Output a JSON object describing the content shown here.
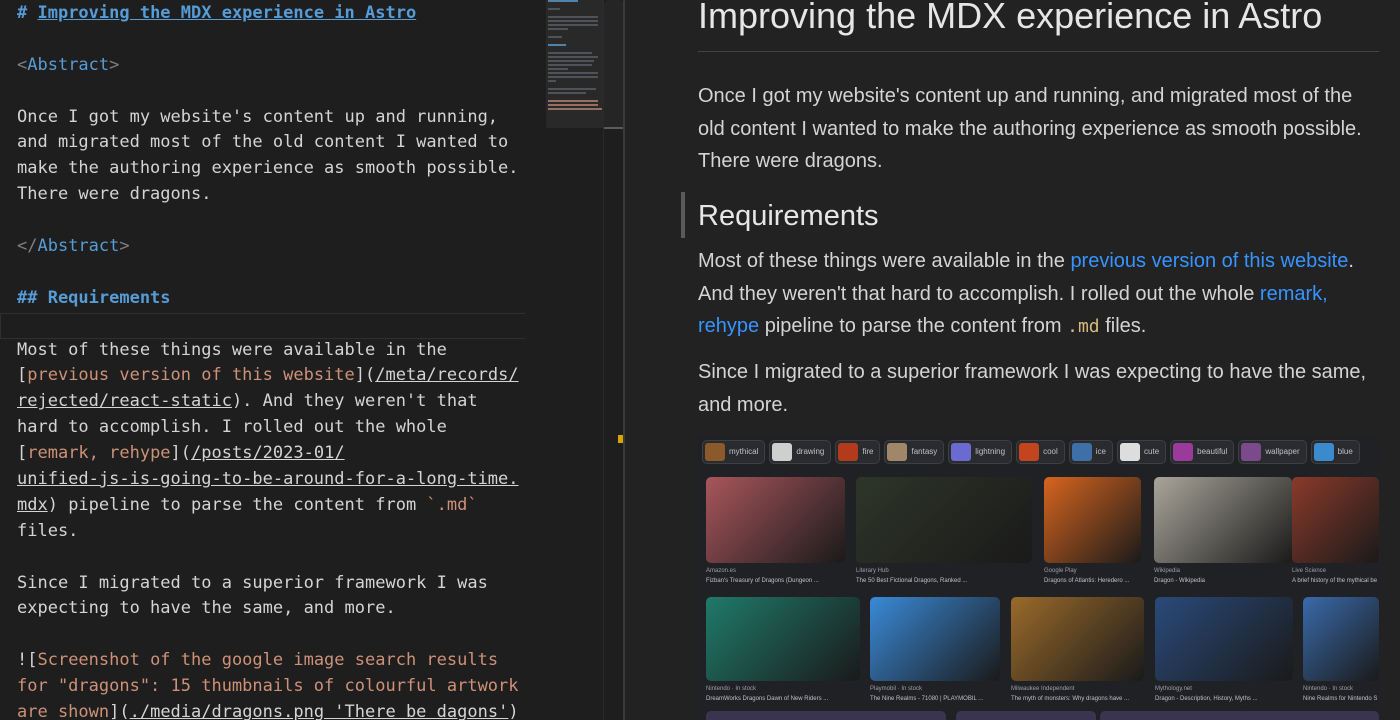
{
  "editor": {
    "lines": [
      {
        "k": "h1",
        "prefix": "# ",
        "text": "Improving the MDX experience in Astro"
      },
      {
        "k": "blank"
      },
      {
        "k": "tagopen",
        "name": "Abstract"
      },
      {
        "k": "blank"
      },
      {
        "k": "text",
        "text": "Once I got my website's content up and running,"
      },
      {
        "k": "text",
        "text": "and migrated most of the old content I wanted to"
      },
      {
        "k": "text",
        "text": "make the authoring experience as smooth possible."
      },
      {
        "k": "text",
        "text": "There were dragons."
      },
      {
        "k": "blank"
      },
      {
        "k": "tagclose",
        "name": "Abstract"
      },
      {
        "k": "blank"
      },
      {
        "k": "h2",
        "text": "## Requirements"
      },
      {
        "k": "blank"
      },
      {
        "k": "text",
        "text": "Most of these things were available in the"
      },
      {
        "k": "link1",
        "open": "[",
        "label": "previous version of this website",
        "mid": "](",
        "url": "/meta/records/"
      },
      {
        "k": "link1b",
        "url": "rejected/react-static",
        "rest": "). And they weren't that"
      },
      {
        "k": "text",
        "text": "hard to accomplish. I rolled out the whole"
      },
      {
        "k": "link2",
        "open": "[",
        "label": "remark, rehype",
        "mid": "](",
        "url": "/posts/2023-01/"
      },
      {
        "k": "urlonly",
        "url": "unified-js-is-going-to-be-around-for-a-long-time."
      },
      {
        "k": "link2c",
        "url": "mdx",
        "rest": ") pipeline to parse the content from ",
        "code": "`.md`"
      },
      {
        "k": "text",
        "text": "files."
      },
      {
        "k": "blank"
      },
      {
        "k": "text",
        "text": "Since I migrated to a superior framework I was"
      },
      {
        "k": "text",
        "text": "expecting to have the same, and more."
      },
      {
        "k": "blank"
      },
      {
        "k": "img1",
        "open": "![",
        "alt": "Screenshot of the google image search results"
      },
      {
        "k": "img2",
        "alt": "for \"dragons\": 15 thumbnails of colourful artwork"
      },
      {
        "k": "img3",
        "alt": "are shown",
        "mid": "](",
        "url": "./media/dragons.png 'There be dagons'",
        "close": ")"
      }
    ]
  },
  "preview": {
    "title": "Improving the MDX experience in Astro",
    "abstract": "Once I got my website's content up and running, and migrated most of the old content I wanted to make the authoring experience as smooth possible. There were dragons.",
    "h2": "Requirements",
    "p1_a": "Most of these things were available in the ",
    "p1_link1": "previous version of this website",
    "p1_b": ". And they weren't that hard to accomplish. I rolled out the whole ",
    "p1_link2": "remark, rehype",
    "p1_c": " pipeline to parse the content from ",
    "p1_code": ".md",
    "p1_d": " files.",
    "p2": "Since I migrated to a superior framework I was expecting to have the same, and more."
  },
  "image": {
    "chips": [
      "mythical",
      "drawing",
      "fire",
      "fantasy",
      "lightning",
      "cool",
      "ice",
      "cute",
      "beautiful",
      "wallpaper",
      "blue"
    ],
    "row1": [
      {
        "src": "Amazon.es",
        "cap": "Fizban's Treasury of Dragons (Dungeon ..."
      },
      {
        "src": "Literary Hub",
        "cap": "The 50 Best Fictional Dragons, Ranked ..."
      },
      {
        "src": "Google Play",
        "cap": "Dragons of Atlantis: Heredero ..."
      },
      {
        "src": "Wikipedia",
        "cap": "Dragon - Wikipedia"
      },
      {
        "src": "Live Science",
        "cap": "A brief history of the mythical be"
      }
    ],
    "row2": [
      {
        "src": "Nintendo · In stock",
        "cap": "DreamWorks Dragons Dawn of New Riders ..."
      },
      {
        "src": "Playmobil · In stock",
        "cap": "The Nine Realms - 71080 | PLAYMOBIL ..."
      },
      {
        "src": "Milwaukee Independent",
        "cap": "The myth of monsters: Why dragons have ..."
      },
      {
        "src": "Mythology.net",
        "cap": "Dragon - Description, History, Myths ..."
      },
      {
        "src": "Nintendo · In stock",
        "cap": "Nine Realms for Nintendo S"
      }
    ],
    "colors": {
      "chips": [
        "#8a5a2b",
        "#cfcfcf",
        "#b33a1a",
        "#a0876a",
        "#6a6ad0",
        "#c2451f",
        "#3f6fa8",
        "#ddd",
        "#9a3a9a",
        "#7a4a8a",
        "#3a8acd"
      ],
      "row1": [
        "#a8565c",
        "#2e3528",
        "#d7651f",
        "#a9a59a",
        "#8a3a2a"
      ],
      "row2": [
        "#1f7a6a",
        "#3a8ad8",
        "#9a6a2a",
        "#2a4a7a",
        "#3a6aaa"
      ]
    }
  }
}
